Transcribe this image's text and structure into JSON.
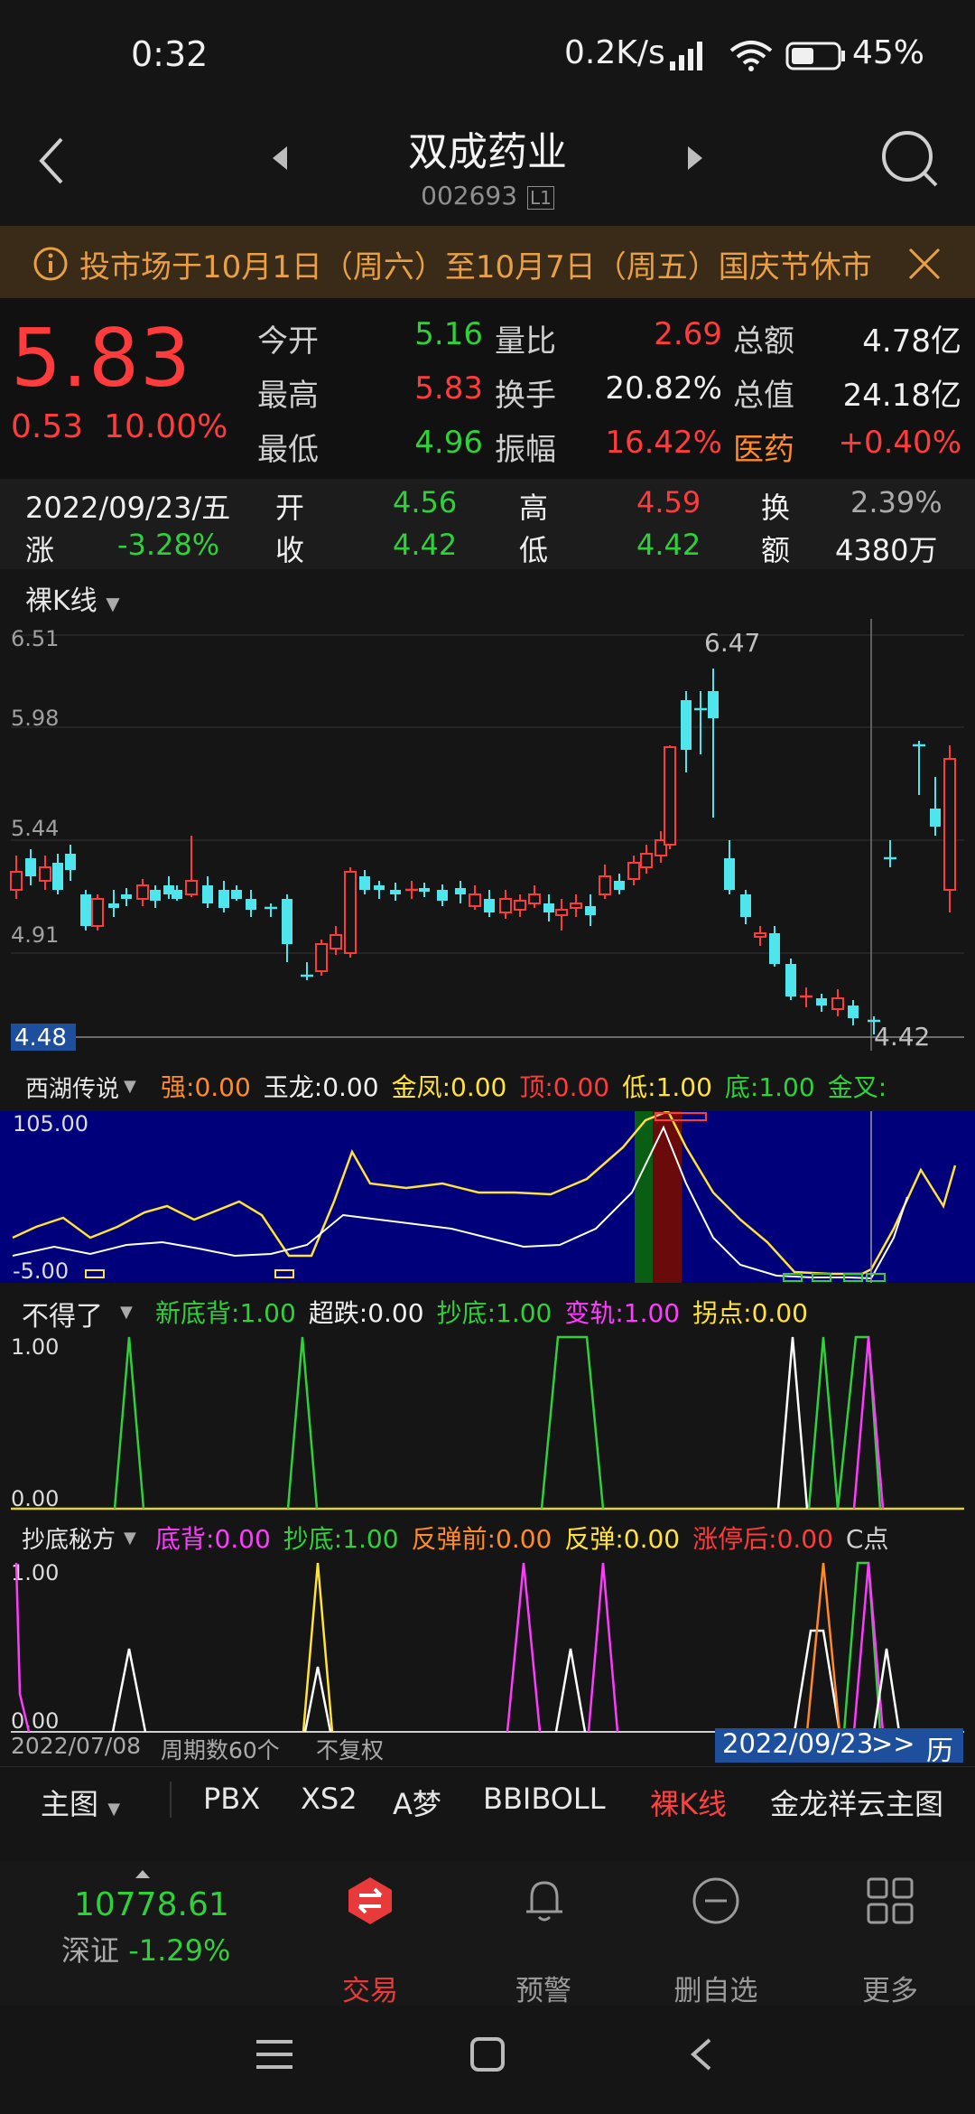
{
  "status": {
    "time": "0:32",
    "net": "0.2K/s",
    "battery": "45%"
  },
  "header": {
    "title": "双成药业",
    "code": "002693",
    "badge": "L1"
  },
  "notice": {
    "text": "投市场于10月1日（周六）至10月7日（周五）国庆节休市"
  },
  "quote": {
    "price": "5.83",
    "change": "0.53",
    "change_pct": "10.00%",
    "today_open_label": "今开",
    "today_open": "5.16",
    "high_label": "最高",
    "high": "5.83",
    "low_label": "最低",
    "low": "4.96",
    "vol_ratio_label": "量比",
    "vol_ratio": "2.69",
    "turnover_label": "换手",
    "turnover": "20.82%",
    "amplitude_label": "振幅",
    "amplitude": "16.42%",
    "amount_label": "总额",
    "amount": "4.78亿",
    "mktcap_label": "总值",
    "mktcap": "24.18亿",
    "sector_label": "医药",
    "sector": "+0.40%"
  },
  "day": {
    "date": "2022/09/23/五",
    "zhang_label": "涨",
    "zhang": "-3.28%",
    "open_label": "开",
    "open": "4.56",
    "close_label": "收",
    "close": "4.42",
    "high_label": "高",
    "high": "4.59",
    "low_label": "低",
    "low": "4.42",
    "turn_label": "换",
    "turn": "2.39%",
    "amt_label": "额",
    "amt": "4380万"
  },
  "kline": {
    "selector": "裸K线",
    "ticks": [
      "6.51",
      "5.98",
      "5.44",
      "4.91",
      "4.48"
    ],
    "max_label": "6.47",
    "min_label": "4.42"
  },
  "ind1": {
    "name": "西湖传说",
    "items": [
      {
        "label": "强:",
        "value": "0.00",
        "color": "#ff8a26"
      },
      {
        "label": "玉龙:",
        "value": "0.00",
        "color": "#f0f0f0"
      },
      {
        "label": "金凤:",
        "value": "0.00",
        "color": "#ffe23a"
      },
      {
        "label": "顶:",
        "value": "0.00",
        "color": "#ff3b3b"
      },
      {
        "label": "低:",
        "value": "1.00",
        "color": "#ffe23a"
      },
      {
        "label": "底:",
        "value": "1.00",
        "color": "#2fd13b"
      },
      {
        "label": "金叉:",
        "value": "",
        "color": "#2fd13b"
      }
    ],
    "top": "105.00",
    "bottom": "-5.00"
  },
  "ind2": {
    "name": "不得了",
    "items": [
      {
        "label": "新底背:",
        "value": "1.00",
        "color": "#2fd13b"
      },
      {
        "label": "超跌:",
        "value": "0.00",
        "color": "#f0f0f0"
      },
      {
        "label": "抄底:",
        "value": "1.00",
        "color": "#2fd13b"
      },
      {
        "label": "变轨:",
        "value": "1.00",
        "color": "#ff3bff"
      },
      {
        "label": "拐点:",
        "value": "0.00",
        "color": "#ffe23a"
      }
    ],
    "top": "1.00",
    "bottom": "0.00"
  },
  "ind3": {
    "name": "抄底秘方",
    "items": [
      {
        "label": "底背:",
        "value": "0.00",
        "color": "#ff3bff"
      },
      {
        "label": "抄底:",
        "value": "1.00",
        "color": "#2fd13b"
      },
      {
        "label": "反弹前:",
        "value": "0.00",
        "color": "#ff8a26"
      },
      {
        "label": "反弹:",
        "value": "0.00",
        "color": "#ffe23a"
      },
      {
        "label": "涨停后:",
        "value": "0.00",
        "color": "#ff3b3b"
      },
      {
        "label": "C点",
        "value": "",
        "color": "#d0d0d0"
      }
    ],
    "top": "1.00",
    "bottom": "0.00"
  },
  "footer": {
    "start": "2022/07/08",
    "periods": "周期数60个",
    "adj": "不复权",
    "cursor_date": "2022/09/23",
    "hist": "历"
  },
  "tabs": {
    "main": "主图",
    "items": [
      "PBX",
      "XS2",
      "A梦",
      "BBIBOLL",
      "裸K线",
      "金龙祥云主图"
    ]
  },
  "nav": {
    "index_value": "10778.61",
    "index_name": "深证",
    "index_chg": "-1.29%",
    "items": [
      "交易",
      "预警",
      "删自选",
      "更多"
    ]
  }
}
